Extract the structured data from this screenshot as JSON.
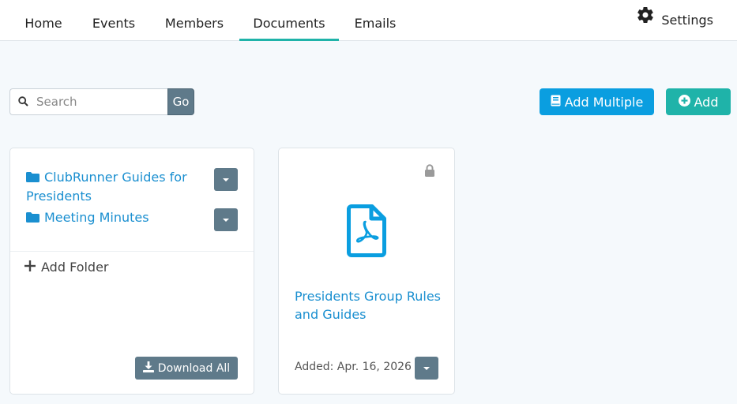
{
  "nav": {
    "tabs": [
      {
        "label": "Home"
      },
      {
        "label": "Events"
      },
      {
        "label": "Members"
      },
      {
        "label": "Documents",
        "active": true
      },
      {
        "label": "Emails"
      }
    ],
    "settings_label": "Settings"
  },
  "toolbar": {
    "search_placeholder": "Search",
    "go_label": "Go",
    "add_multiple_label": "Add Multiple",
    "add_label": "Add"
  },
  "folders": {
    "items": [
      {
        "label": "ClubRunner Guides for Presidents"
      },
      {
        "label": "Meeting Minutes"
      }
    ],
    "add_folder_label": "Add Folder",
    "download_all_label": "Download All"
  },
  "documents": [
    {
      "title": "Presidents Group Rules and Guides",
      "added": "Added: Apr. 16, 2026",
      "icon": "pdf-file-icon",
      "locked": true
    }
  ],
  "colors": {
    "accent_teal": "#1fb3a9",
    "accent_blue": "#0a9ee0",
    "link": "#1a8fd0",
    "slate": "#5f7a8a"
  }
}
